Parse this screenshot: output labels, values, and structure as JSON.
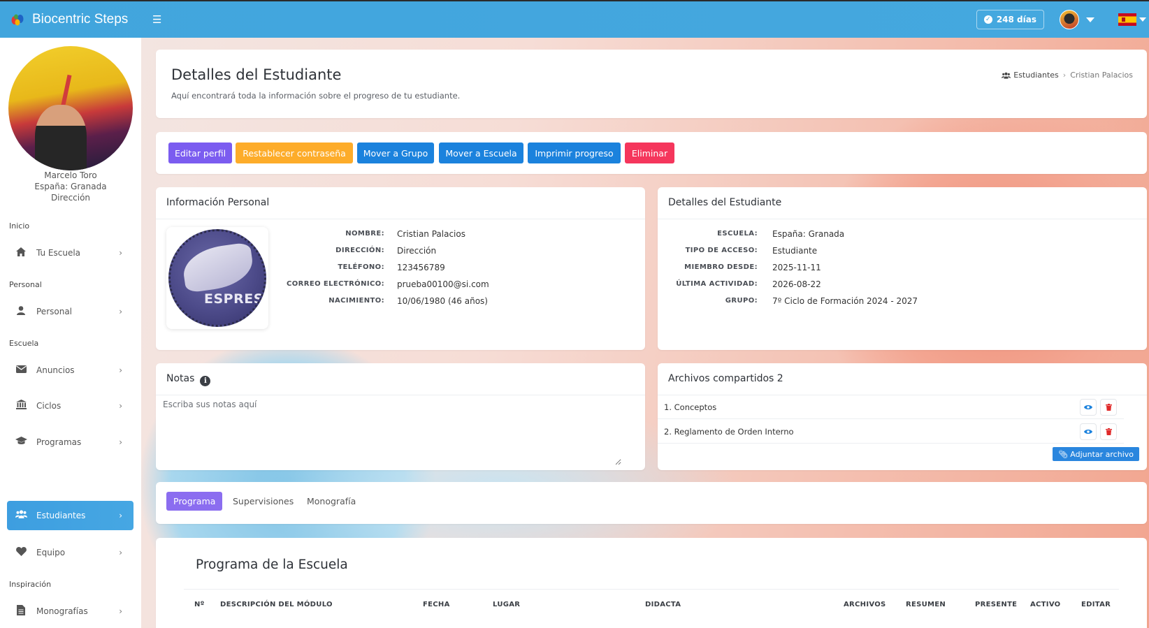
{
  "app": {
    "title": "Biocentric Steps"
  },
  "topbar": {
    "days_label": "248 días",
    "language": "es"
  },
  "sidebar": {
    "user": {
      "name": "Marcelo Toro",
      "school": "España: Granada",
      "role": "Dirección"
    },
    "sections": [
      {
        "label": "Inicio",
        "items": [
          {
            "label": "Tu Escuela",
            "icon": "home-icon"
          }
        ]
      },
      {
        "label": "Personal",
        "items": [
          {
            "label": "Personal",
            "icon": "user-icon"
          }
        ]
      },
      {
        "label": "Escuela",
        "items": [
          {
            "label": "Anuncios",
            "icon": "envelope-icon"
          },
          {
            "label": "Ciclos",
            "icon": "bank-icon"
          },
          {
            "label": "Programas",
            "icon": "graduation-cap-icon"
          },
          {
            "label": "Estudiantes",
            "icon": "users-icon",
            "active": true
          },
          {
            "label": "Equipo",
            "icon": "heart-icon"
          }
        ]
      },
      {
        "label": "Inspiración",
        "items": [
          {
            "label": "Monografías",
            "icon": "document-icon"
          }
        ]
      }
    ]
  },
  "header": {
    "title": "Detalles del Estudiante",
    "subtitle": "Aquí encontrará toda la información sobre el progreso de tu estudiante.",
    "breadcrumb": {
      "parent": "Estudiantes",
      "current": "Cristian Palacios"
    }
  },
  "actions": {
    "edit_profile": "Editar perfil",
    "reset_password": "Restablecer contraseña",
    "move_group": "Mover a Grupo",
    "move_school": "Mover a Escuela",
    "print_progress": "Imprimir progreso",
    "delete": "Eliminar"
  },
  "colors": {
    "topbar": "#41a5dd",
    "edit": "#7b5cf0",
    "reset": "#fdac2a",
    "primary": "#1b82dd",
    "danger": "#f5365c",
    "tab_active": "#8b6df0"
  },
  "personal_info": {
    "title": "Información Personal",
    "avatar_text": "ESPRESS",
    "fields": [
      {
        "label": "NOMBRE:",
        "value": "Cristian Palacios"
      },
      {
        "label": "DIRECCIÓN:",
        "value": "Dirección"
      },
      {
        "label": "TELÉFONO:",
        "value": "123456789"
      },
      {
        "label": "CORREO ELECTRÓNICO:",
        "value": "prueba00100@si.com"
      },
      {
        "label": "NACIMIENTO:",
        "value": "10/06/1980 (46 años)"
      }
    ]
  },
  "student_details": {
    "title": "Detalles del Estudiante",
    "fields": [
      {
        "label": "ESCUELA:",
        "value": "España: Granada"
      },
      {
        "label": "TIPO DE ACCESO:",
        "value": "Estudiante"
      },
      {
        "label": "MIEMBRO DESDE:",
        "value": "2025-11-11"
      },
      {
        "label": "ÚLTIMA ACTIVIDAD:",
        "value": "2026-08-22"
      },
      {
        "label": "GRUPO:",
        "value": "7º Ciclo de Formación 2024 - 2027"
      }
    ]
  },
  "notes": {
    "title": "Notas",
    "placeholder": "Escriba sus notas aquí"
  },
  "shared_files": {
    "title": "Archivos compartidos 2",
    "files": [
      "1. Conceptos",
      "2. Reglamento de Orden Interno"
    ],
    "attach_label": "Adjuntar archivo"
  },
  "tabs": [
    {
      "label": "Programa",
      "active": true
    },
    {
      "label": "Supervisiones"
    },
    {
      "label": "Monografía"
    }
  ],
  "program": {
    "title": "Programa de la Escuela",
    "columns": [
      "Nº",
      "DESCRIPCIÓN DEL MÓDULO",
      "FECHA",
      "LUGAR",
      "DIDACTA",
      "ARCHIVOS",
      "RESUMEN",
      "PRESENTE",
      "ACTIVO",
      "EDITAR"
    ]
  }
}
